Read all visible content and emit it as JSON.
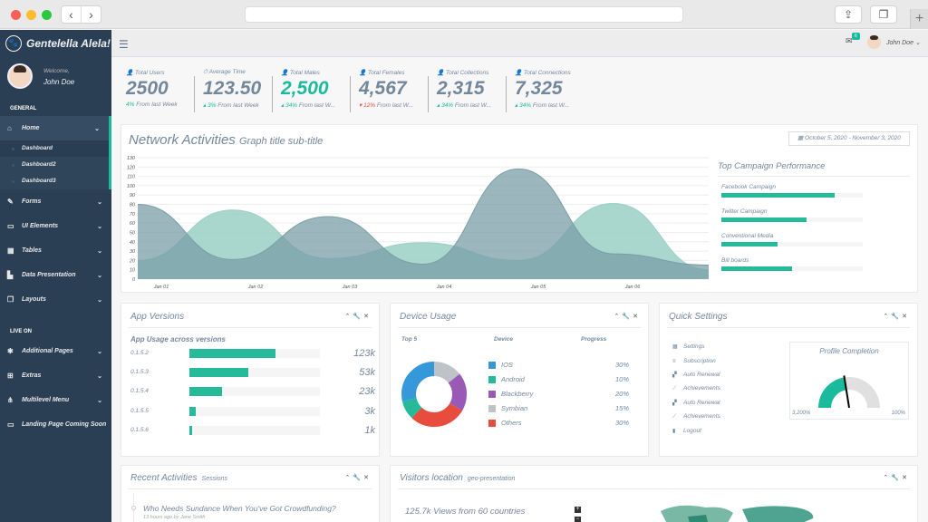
{
  "app": {
    "brand": "Gentelella Alela!",
    "welcome": "Welcome,",
    "user": "John Doe"
  },
  "sidebar": {
    "general_title": "GENERAL",
    "live_title": "LIVE ON",
    "home": "Home",
    "home_sub": [
      "Dashboard",
      "Dashboard2",
      "Dashboard3"
    ],
    "general_items": [
      "Forms",
      "UI Elements",
      "Tables",
      "Data Presentation",
      "Layouts"
    ],
    "live_items": [
      "Additional Pages",
      "Extras",
      "Multilevel Menu",
      "Landing Page Coming Soon"
    ]
  },
  "topbar": {
    "mail_count": "6",
    "user": "John Doe"
  },
  "tiles": [
    {
      "title": "Total Users",
      "count": "2500",
      "delta": "4%",
      "suffix": "From last Week",
      "trend": "up",
      "highlight": false
    },
    {
      "title": "Average Time",
      "count": "123.50",
      "delta": "3%",
      "suffix": "From last Week",
      "trend": "up",
      "highlight": false
    },
    {
      "title": "Total Males",
      "count": "2,500",
      "delta": "34%",
      "suffix": "From last W...",
      "trend": "up",
      "highlight": true
    },
    {
      "title": "Total Females",
      "count": "4,567",
      "delta": "12%",
      "suffix": "From last W...",
      "trend": "down",
      "highlight": false
    },
    {
      "title": "Total Collections",
      "count": "2,315",
      "delta": "34%",
      "suffix": "From last W...",
      "trend": "up",
      "highlight": false
    },
    {
      "title": "Total Connections",
      "count": "7,325",
      "delta": "34%",
      "suffix": "From last W...",
      "trend": "up",
      "highlight": false
    }
  ],
  "network": {
    "title": "Network Activities",
    "subtitle": "Graph title sub-title",
    "daterange": "October 5, 2020 - November 3, 2020"
  },
  "chart_data": {
    "type": "area",
    "x": [
      "Jan 01",
      "Jan 02",
      "Jan 03",
      "Jan 04",
      "Jan 05",
      "Jan 06"
    ],
    "yticks": [
      0,
      10,
      20,
      30,
      40,
      50,
      60,
      70,
      80,
      90,
      100,
      110,
      120,
      130
    ],
    "ylim": [
      0,
      130
    ],
    "series": [
      {
        "values": [
          20,
          74,
          22,
          39,
          20,
          81,
          10
        ],
        "color": "#9ad0c4"
      },
      {
        "values": [
          80,
          21,
          67,
          16,
          118,
          27,
          15
        ],
        "color": "#7a9ea7"
      }
    ],
    "grid": true
  },
  "campaign": {
    "title": "Top Campaign Performance",
    "items": [
      {
        "label": "Facebook Campaign",
        "value": 80
      },
      {
        "label": "Twitter Campaign",
        "value": 60
      },
      {
        "label": "Conventional Media",
        "value": 40
      },
      {
        "label": "Bill boards",
        "value": 50
      }
    ]
  },
  "app_versions": {
    "title": "App Versions",
    "subtitle": "App Usage across versions",
    "rows": [
      {
        "version": "0.1.5.2",
        "value": "123k",
        "pct": 66
      },
      {
        "version": "0.1.5.3",
        "value": "53k",
        "pct": 45
      },
      {
        "version": "0.1.5.4",
        "value": "23k",
        "pct": 25
      },
      {
        "version": "0.1.5.5",
        "value": "3k",
        "pct": 5
      },
      {
        "version": "0.1.5.6",
        "value": "1k",
        "pct": 2
      }
    ]
  },
  "device_usage": {
    "title": "Device Usage",
    "col_top": "Top 5",
    "col_device": "Device",
    "col_progress": "Progress",
    "items": [
      {
        "label": "IOS",
        "pct": "30%",
        "value": 30,
        "color": "#3498db"
      },
      {
        "label": "Android",
        "pct": "10%",
        "value": 10,
        "color": "#26b99a"
      },
      {
        "label": "Blackberry",
        "pct": "20%",
        "value": 20,
        "color": "#9b59b6"
      },
      {
        "label": "Symbian",
        "pct": "15%",
        "value": 15,
        "color": "#bdc3c7"
      },
      {
        "label": "Others",
        "pct": "30%",
        "value": 30,
        "color": "#e74c3c"
      }
    ]
  },
  "quick_settings": {
    "title": "Quick Settings",
    "items": [
      {
        "icon": "calendar-icon",
        "glyph": "▦",
        "label": "Settings"
      },
      {
        "icon": "bars-icon",
        "glyph": "≡",
        "label": "Subscription"
      },
      {
        "icon": "chart-icon",
        "glyph": "▞",
        "label": "Auto Renewal"
      },
      {
        "icon": "line-chart-icon",
        "glyph": "⟋",
        "label": "Achievements"
      },
      {
        "icon": "chart-icon",
        "glyph": "▞",
        "label": "Auto Renewal"
      },
      {
        "icon": "line-chart-icon",
        "glyph": "⟋",
        "label": "Achievements"
      },
      {
        "icon": "signal-icon",
        "glyph": "▮",
        "label": "Logout"
      }
    ],
    "profile": {
      "title": "Profile Completion",
      "min": "3,200%",
      "max": "100%",
      "level": 0.45
    }
  },
  "recent": {
    "title": "Recent Activities",
    "subtitle": "Sessions",
    "item_title": "Who Needs Sundance When You've Got Crowdfunding?",
    "item_meta": "13 hours ago by Jane Smith"
  },
  "visitors": {
    "title": "Visitors location",
    "subtitle": "geo-presentation",
    "views": "125.7k Views from 60 countries"
  },
  "colors": {
    "accent": "#1abb9c",
    "sidebar": "#2a3f54"
  }
}
